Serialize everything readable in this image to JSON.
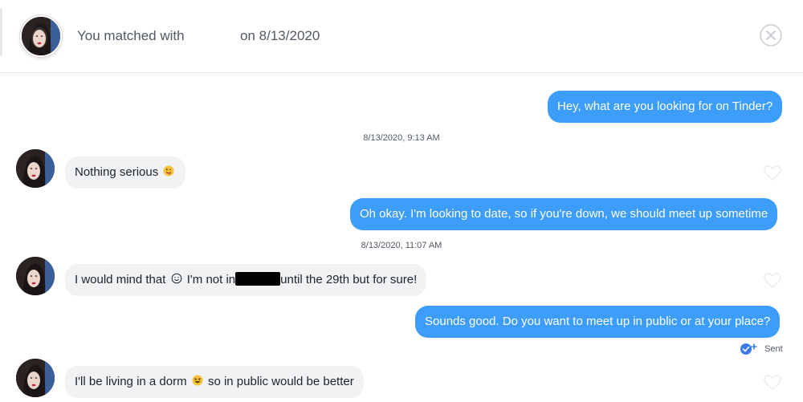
{
  "header": {
    "match_prefix": "You matched with",
    "match_date": "on 8/13/2020"
  },
  "messages": {
    "m1": "Hey, what are you looking for on Tinder?",
    "ts1": "8/13/2020, 9:13 AM",
    "m2": "Nothing serious",
    "m3": "Oh okay. I'm looking to date, so if you're down, we should meet up sometime",
    "ts2": "8/13/2020, 11:07 AM",
    "m4_part1": "I would mind that",
    "m4_part2": "I'm not in",
    "m4_part3": "until the 29th but for sure!",
    "m5": "Sounds good. Do you want to meet up in public or at your place?",
    "sent_label": "Sent",
    "m6_part1": "I'll be living in a dorm",
    "m6_part2": "so in public would be better"
  },
  "colors": {
    "outgoing_bubble": "#3c9dfa",
    "incoming_bubble": "#f0f2f4",
    "redaction": "#000000"
  },
  "icons": {
    "close": "close-circle-icon",
    "like": "heart-outline-icon",
    "sent": "sent-check-icon"
  }
}
